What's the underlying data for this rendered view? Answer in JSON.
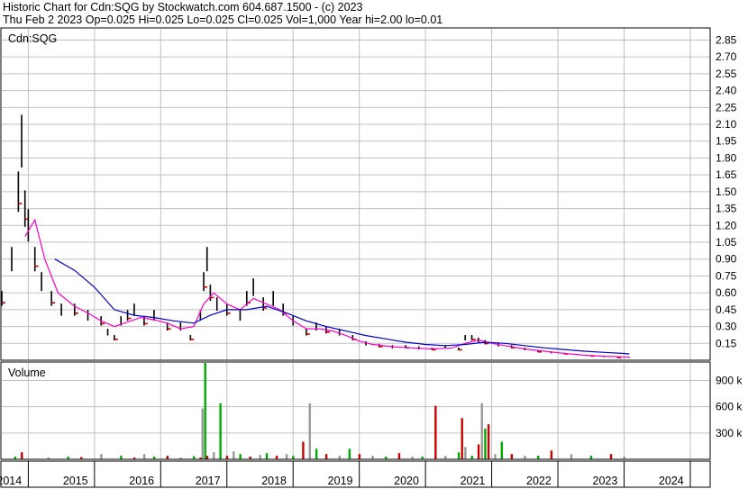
{
  "header": {
    "title": "Historic Chart for Cdn:SQG by Stockwatch.com 604.687.1500 - (c) 2023",
    "quote": "Thu Feb  2 2023  Op=0.025  Hi=0.025  Lo=0.025  Cl=0.025  Vol=1,000  Year hi=2.00  lo=0.01"
  },
  "colors": {
    "price_bar": "#000000",
    "down_bar": "#cc0000",
    "ma_short": "#ff00cc",
    "ma_long": "#0000cc",
    "vol_up": "#00aa00",
    "vol_down": "#cc0000",
    "vol_neutral": "#999999",
    "grid": "#c0c0c0"
  },
  "chart_data": [
    {
      "type": "line",
      "title": "Cdn:SQG",
      "xlabel": "",
      "ylabel": "",
      "grid": true,
      "ylim": [
        0,
        2.95
      ],
      "xlim": [
        2013.6,
        2024.3
      ],
      "y_ticks": [
        "0.15",
        "0.30",
        "0.45",
        "0.60",
        "0.75",
        "0.90",
        "1.05",
        "1.20",
        "1.35",
        "1.50",
        "1.65",
        "1.80",
        "1.95",
        "2.10",
        "2.25",
        "2.40",
        "2.55",
        "2.70",
        "2.85"
      ],
      "x_ticks": [
        "2014",
        "2015",
        "2016",
        "2017",
        "2018",
        "2019",
        "2020",
        "2021",
        "2022",
        "2023",
        "2024"
      ],
      "series": [
        {
          "values": [
            [
              2013.6,
              0.55
            ],
            [
              2013.75,
              0.9
            ],
            [
              2013.85,
              1.5
            ],
            [
              2013.9,
              1.95
            ],
            [
              2013.95,
              1.35
            ],
            [
              2014.0,
              1.2
            ],
            [
              2014.1,
              0.9
            ],
            [
              2014.2,
              0.7
            ],
            [
              2014.35,
              0.55
            ],
            [
              2014.5,
              0.45
            ],
            [
              2014.7,
              0.45
            ],
            [
              2014.9,
              0.4
            ],
            [
              2015.1,
              0.35
            ],
            [
              2015.2,
              0.25
            ],
            [
              2015.3,
              0.2
            ],
            [
              2015.4,
              0.35
            ],
            [
              2015.5,
              0.4
            ],
            [
              2015.6,
              0.45
            ],
            [
              2015.75,
              0.35
            ],
            [
              2015.9,
              0.4
            ],
            [
              2016.1,
              0.3
            ],
            [
              2016.3,
              0.3
            ],
            [
              2016.45,
              0.2
            ],
            [
              2016.6,
              0.4
            ],
            [
              2016.65,
              0.7
            ],
            [
              2016.7,
              0.9
            ],
            [
              2016.75,
              0.6
            ],
            [
              2016.85,
              0.5
            ],
            [
              2017.0,
              0.45
            ],
            [
              2017.2,
              0.4
            ],
            [
              2017.3,
              0.55
            ],
            [
              2017.4,
              0.65
            ],
            [
              2017.55,
              0.5
            ],
            [
              2017.7,
              0.55
            ],
            [
              2017.85,
              0.45
            ],
            [
              2018.0,
              0.35
            ],
            [
              2018.2,
              0.25
            ],
            [
              2018.35,
              0.3
            ],
            [
              2018.5,
              0.27
            ],
            [
              2018.7,
              0.25
            ],
            [
              2018.9,
              0.2
            ],
            [
              2019.1,
              0.15
            ],
            [
              2019.3,
              0.13
            ],
            [
              2019.5,
              0.12
            ],
            [
              2019.7,
              0.12
            ],
            [
              2019.9,
              0.11
            ],
            [
              2020.1,
              0.1
            ],
            [
              2020.3,
              0.12
            ],
            [
              2020.5,
              0.1
            ],
            [
              2020.6,
              0.2
            ],
            [
              2020.7,
              0.2
            ],
            [
              2020.8,
              0.18
            ],
            [
              2020.9,
              0.16
            ],
            [
              2021.1,
              0.14
            ],
            [
              2021.3,
              0.12
            ],
            [
              2021.5,
              0.1
            ],
            [
              2021.7,
              0.08
            ],
            [
              2021.9,
              0.07
            ],
            [
              2022.1,
              0.06
            ],
            [
              2022.3,
              0.05
            ],
            [
              2022.5,
              0.04
            ],
            [
              2022.7,
              0.03
            ],
            [
              2022.9,
              0.025
            ],
            [
              2023.08,
              0.025
            ]
          ]
        },
        {
          "values": [
            [
              2013.95,
              1.1
            ],
            [
              2014.1,
              1.25
            ],
            [
              2014.25,
              0.9
            ],
            [
              2014.45,
              0.6
            ],
            [
              2014.7,
              0.48
            ],
            [
              2014.9,
              0.42
            ],
            [
              2015.1,
              0.35
            ],
            [
              2015.3,
              0.3
            ],
            [
              2015.5,
              0.34
            ],
            [
              2015.7,
              0.38
            ],
            [
              2015.9,
              0.36
            ],
            [
              2016.1,
              0.33
            ],
            [
              2016.3,
              0.28
            ],
            [
              2016.5,
              0.3
            ],
            [
              2016.65,
              0.5
            ],
            [
              2016.8,
              0.6
            ],
            [
              2017.0,
              0.5
            ],
            [
              2017.2,
              0.45
            ],
            [
              2017.4,
              0.55
            ],
            [
              2017.6,
              0.5
            ],
            [
              2017.8,
              0.45
            ],
            [
              2018.0,
              0.35
            ],
            [
              2018.2,
              0.28
            ],
            [
              2018.4,
              0.28
            ],
            [
              2018.6,
              0.26
            ],
            [
              2018.8,
              0.22
            ],
            [
              2019.0,
              0.17
            ],
            [
              2019.2,
              0.14
            ],
            [
              2019.5,
              0.12
            ],
            [
              2019.8,
              0.11
            ],
            [
              2020.1,
              0.1
            ],
            [
              2020.4,
              0.11
            ],
            [
              2020.6,
              0.15
            ],
            [
              2020.8,
              0.18
            ],
            [
              2021.0,
              0.15
            ],
            [
              2021.2,
              0.13
            ],
            [
              2021.5,
              0.1
            ],
            [
              2021.8,
              0.08
            ],
            [
              2022.1,
              0.06
            ],
            [
              2022.4,
              0.045
            ],
            [
              2022.7,
              0.035
            ],
            [
              2023.0,
              0.03
            ],
            [
              2023.08,
              0.028
            ]
          ]
        },
        {
          "values": [
            [
              2014.4,
              0.9
            ],
            [
              2014.7,
              0.8
            ],
            [
              2015.0,
              0.65
            ],
            [
              2015.3,
              0.45
            ],
            [
              2015.6,
              0.4
            ],
            [
              2015.9,
              0.38
            ],
            [
              2016.2,
              0.35
            ],
            [
              2016.5,
              0.33
            ],
            [
              2016.75,
              0.4
            ],
            [
              2017.0,
              0.45
            ],
            [
              2017.3,
              0.45
            ],
            [
              2017.6,
              0.48
            ],
            [
              2017.9,
              0.42
            ],
            [
              2018.2,
              0.35
            ],
            [
              2018.5,
              0.3
            ],
            [
              2018.8,
              0.26
            ],
            [
              2019.1,
              0.22
            ],
            [
              2019.4,
              0.19
            ],
            [
              2019.7,
              0.16
            ],
            [
              2020.0,
              0.14
            ],
            [
              2020.3,
              0.13
            ],
            [
              2020.6,
              0.14
            ],
            [
              2020.9,
              0.16
            ],
            [
              2021.2,
              0.15
            ],
            [
              2021.5,
              0.13
            ],
            [
              2021.8,
              0.11
            ],
            [
              2022.1,
              0.095
            ],
            [
              2022.4,
              0.08
            ],
            [
              2022.7,
              0.07
            ],
            [
              2023.0,
              0.06
            ],
            [
              2023.08,
              0.055
            ]
          ]
        }
      ]
    },
    {
      "type": "bar",
      "title": "Volume",
      "ylim": [
        0,
        1100
      ],
      "y_ticks": [
        "300 k",
        "600 k",
        "900 k"
      ],
      "series": [
        {
          "values": [
            [
              2013.8,
              30
            ],
            [
              2013.9,
              80
            ],
            [
              2014.3,
              20
            ],
            [
              2014.6,
              30
            ],
            [
              2014.8,
              25
            ],
            [
              2015.1,
              60
            ],
            [
              2015.4,
              40
            ],
            [
              2015.6,
              20
            ],
            [
              2015.75,
              60
            ],
            [
              2015.9,
              30
            ],
            [
              2016.1,
              40
            ],
            [
              2016.3,
              20
            ],
            [
              2016.5,
              35
            ],
            [
              2016.6,
              20
            ],
            [
              2016.63,
              580
            ],
            [
              2016.67,
              1100
            ],
            [
              2016.7,
              40
            ],
            [
              2016.8,
              80
            ],
            [
              2016.9,
              640
            ],
            [
              2017.0,
              40
            ],
            [
              2017.1,
              90
            ],
            [
              2017.2,
              60
            ],
            [
              2017.35,
              30
            ],
            [
              2017.5,
              50
            ],
            [
              2017.6,
              70
            ],
            [
              2017.75,
              40
            ],
            [
              2017.9,
              60
            ],
            [
              2018.0,
              40
            ],
            [
              2018.15,
              200
            ],
            [
              2018.25,
              640
            ],
            [
              2018.35,
              120
            ],
            [
              2018.5,
              60
            ],
            [
              2018.7,
              40
            ],
            [
              2018.85,
              120
            ],
            [
              2019.0,
              60
            ],
            [
              2019.2,
              40
            ],
            [
              2019.4,
              30
            ],
            [
              2019.6,
              70
            ],
            [
              2019.8,
              30
            ],
            [
              2019.95,
              30
            ],
            [
              2020.15,
              610
            ],
            [
              2020.3,
              40
            ],
            [
              2020.5,
              80
            ],
            [
              2020.55,
              470
            ],
            [
              2020.6,
              140
            ],
            [
              2020.7,
              40
            ],
            [
              2020.8,
              170
            ],
            [
              2020.85,
              640
            ],
            [
              2020.9,
              350
            ],
            [
              2020.95,
              400
            ],
            [
              2021.05,
              60
            ],
            [
              2021.15,
              200
            ],
            [
              2021.3,
              60
            ],
            [
              2021.5,
              40
            ],
            [
              2021.7,
              40
            ],
            [
              2021.9,
              100
            ],
            [
              2022.2,
              60
            ],
            [
              2022.5,
              40
            ],
            [
              2022.8,
              60
            ],
            [
              2023.0,
              30
            ]
          ]
        }
      ]
    }
  ]
}
